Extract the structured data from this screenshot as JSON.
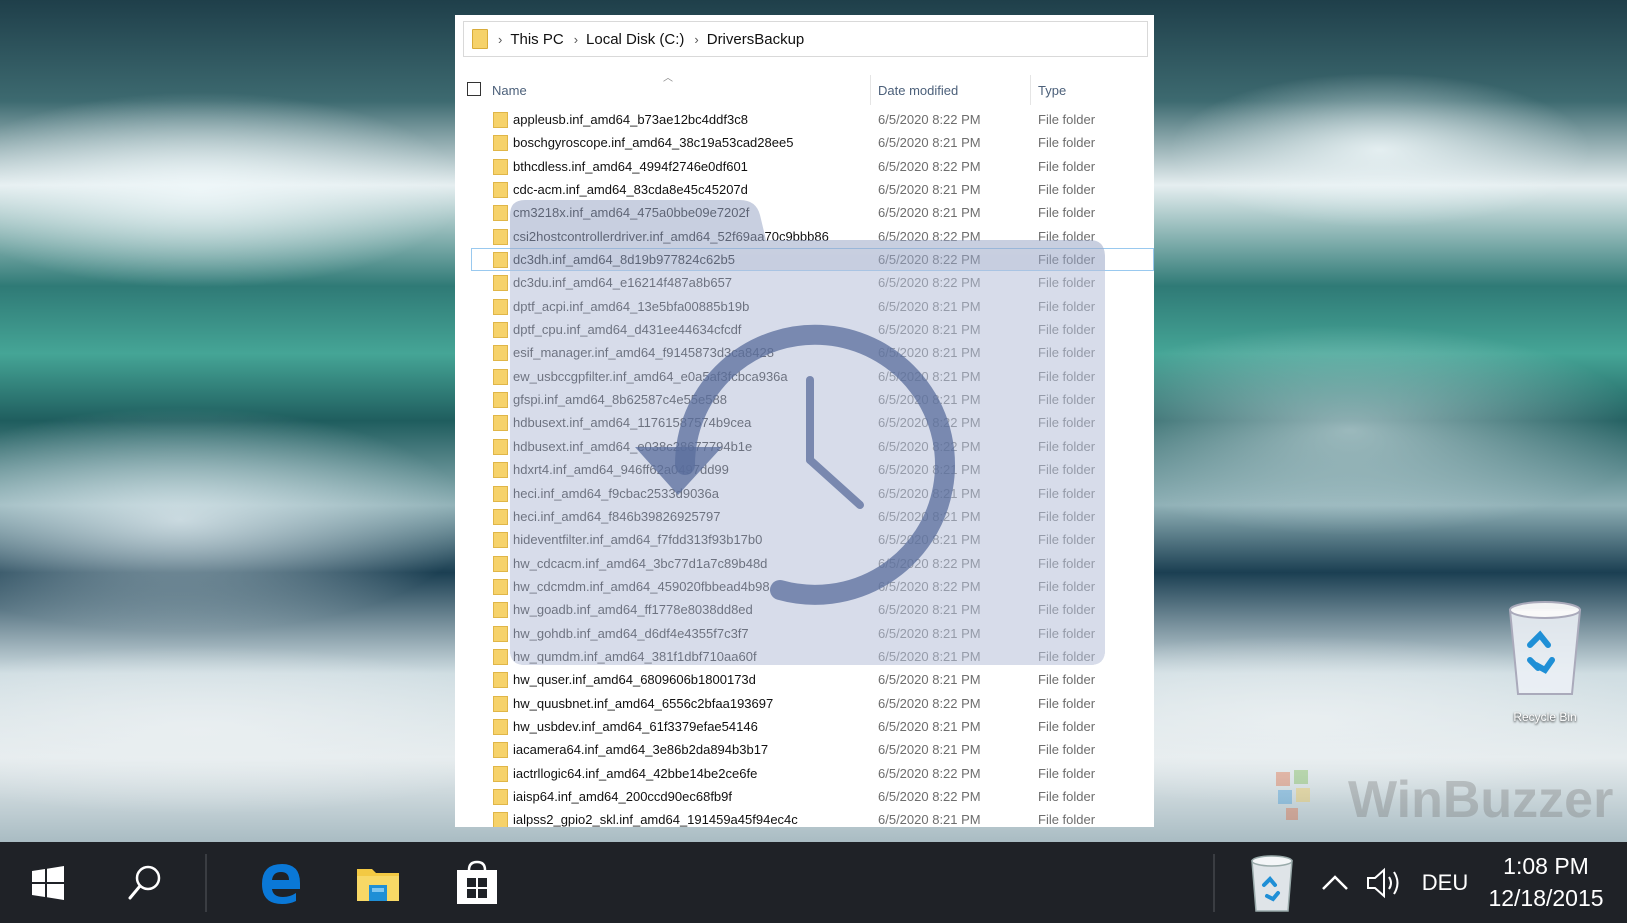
{
  "explorer": {
    "breadcrumb": [
      "This PC",
      "Local Disk (C:)",
      "DriversBackup"
    ],
    "columns": {
      "name": "Name",
      "date": "Date modified",
      "type": "Type"
    },
    "rows": [
      {
        "name": "appleusb.inf_amd64_b73ae12bc4ddf3c8",
        "date": "6/5/2020 8:22 PM",
        "type": "File folder"
      },
      {
        "name": "boschgyroscope.inf_amd64_38c19a53cad28ee5",
        "date": "6/5/2020 8:21 PM",
        "type": "File folder"
      },
      {
        "name": "bthcdless.inf_amd64_4994f2746e0df601",
        "date": "6/5/2020 8:22 PM",
        "type": "File folder"
      },
      {
        "name": "cdc-acm.inf_amd64_83cda8e45c45207d",
        "date": "6/5/2020 8:21 PM",
        "type": "File folder"
      },
      {
        "name": "cm3218x.inf_amd64_475a0bbe09e7202f",
        "date": "6/5/2020 8:21 PM",
        "type": "File folder"
      },
      {
        "name": "csi2hostcontrollerdriver.inf_amd64_52f69aa70c9bbb86",
        "date": "6/5/2020 8:22 PM",
        "type": "File folder"
      },
      {
        "name": "dc3dh.inf_amd64_8d19b977824c62b5",
        "date": "6/5/2020 8:22 PM",
        "type": "File folder"
      },
      {
        "name": "dc3du.inf_amd64_e16214f487a8b657",
        "date": "6/5/2020 8:22 PM",
        "type": "File folder"
      },
      {
        "name": "dptf_acpi.inf_amd64_13e5bfa00885b19b",
        "date": "6/5/2020 8:21 PM",
        "type": "File folder"
      },
      {
        "name": "dptf_cpu.inf_amd64_d431ee44634cfcdf",
        "date": "6/5/2020 8:21 PM",
        "type": "File folder"
      },
      {
        "name": "esif_manager.inf_amd64_f9145873d3ca8428",
        "date": "6/5/2020 8:21 PM",
        "type": "File folder"
      },
      {
        "name": "ew_usbccgpfilter.inf_amd64_e0a5af3fcbca936a",
        "date": "6/5/2020 8:21 PM",
        "type": "File folder"
      },
      {
        "name": "gfspi.inf_amd64_8b62587c4e55e588",
        "date": "6/5/2020 8:21 PM",
        "type": "File folder"
      },
      {
        "name": "hdbusext.inf_amd64_11761587574b9cea",
        "date": "6/5/2020 8:22 PM",
        "type": "File folder"
      },
      {
        "name": "hdbusext.inf_amd64_e038c28677794b1e",
        "date": "6/5/2020 8:22 PM",
        "type": "File folder"
      },
      {
        "name": "hdxrt4.inf_amd64_946ff62a0497dd99",
        "date": "6/5/2020 8:21 PM",
        "type": "File folder"
      },
      {
        "name": "heci.inf_amd64_f9cbac2533d9036a",
        "date": "6/5/2020 8:21 PM",
        "type": "File folder"
      },
      {
        "name": "heci.inf_amd64_f846b39826925797",
        "date": "6/5/2020 8:21 PM",
        "type": "File folder"
      },
      {
        "name": "hideventfilter.inf_amd64_f7fdd313f93b17b0",
        "date": "6/5/2020 8:21 PM",
        "type": "File folder"
      },
      {
        "name": "hw_cdcacm.inf_amd64_3bc77d1a7c89b48d",
        "date": "6/5/2020 8:22 PM",
        "type": "File folder"
      },
      {
        "name": "hw_cdcmdm.inf_amd64_459020fbbead4b98",
        "date": "6/5/2020 8:22 PM",
        "type": "File folder"
      },
      {
        "name": "hw_goadb.inf_amd64_ff1778e8038dd8ed",
        "date": "6/5/2020 8:21 PM",
        "type": "File folder"
      },
      {
        "name": "hw_gohdb.inf_amd64_d6df4e4355f7c3f7",
        "date": "6/5/2020 8:21 PM",
        "type": "File folder"
      },
      {
        "name": "hw_qumdm.inf_amd64_381f1dbf710aa60f",
        "date": "6/5/2020 8:21 PM",
        "type": "File folder"
      },
      {
        "name": "hw_quser.inf_amd64_6809606b1800173d",
        "date": "6/5/2020 8:21 PM",
        "type": "File folder"
      },
      {
        "name": "hw_quusbnet.inf_amd64_6556c2bfaa193697",
        "date": "6/5/2020 8:22 PM",
        "type": "File folder"
      },
      {
        "name": "hw_usbdev.inf_amd64_61f3379efae54146",
        "date": "6/5/2020 8:21 PM",
        "type": "File folder"
      },
      {
        "name": "iacamera64.inf_amd64_3e86b2da894b3b17",
        "date": "6/5/2020 8:21 PM",
        "type": "File folder"
      },
      {
        "name": "iactrllogic64.inf_amd64_42bbe14be2ce6fe",
        "date": "6/5/2020 8:22 PM",
        "type": "File folder"
      },
      {
        "name": "iaisp64.inf_amd64_200ccd90ec68fb9f",
        "date": "6/5/2020 8:22 PM",
        "type": "File folder"
      },
      {
        "name": "ialpss2_gpio2_skl.inf_amd64_191459a45f94ec4c",
        "date": "6/5/2020 8:21 PM",
        "type": "File folder"
      }
    ]
  },
  "desktop": {
    "recycle_bin_label": "Recycle Bin",
    "watermark_text": "WinBuzzer"
  },
  "taskbar": {
    "apps": [
      "start",
      "search",
      "edge",
      "file-explorer",
      "store"
    ],
    "language": "DEU",
    "time": "1:08 PM",
    "date": "12/18/2015"
  },
  "colors": {
    "taskbar": "#1f2227",
    "folder_yellow": "#f6d26a",
    "header_text": "#4c607a",
    "edge_blue": "#0a78d7",
    "overlay_logo": "#5a6d9c"
  }
}
